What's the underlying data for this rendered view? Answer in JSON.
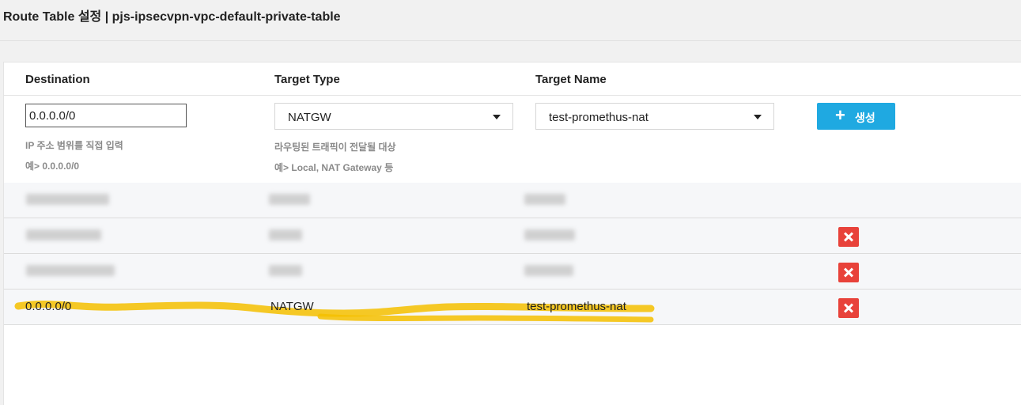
{
  "page": {
    "title": "Route Table 설정 | pjs-ipsecvpn-vpc-default-private-table"
  },
  "table": {
    "headers": {
      "destination": "Destination",
      "target_type": "Target Type",
      "target_name": "Target Name"
    },
    "new_route": {
      "destination_value": "0.0.0.0/0",
      "destination_hint_1": "IP 주소 범위를 직접 입력",
      "destination_hint_2": "예> 0.0.0.0/0",
      "target_type_value": "NATGW",
      "target_type_hint_1": "라우팅된 트래픽이 전달될 대상",
      "target_type_hint_2": "예> Local, NAT Gateway 등",
      "target_name_value": "test-promethus-nat",
      "create_label": "생성",
      "create_icon": "plus-icon"
    },
    "rows": [
      {
        "destination": "",
        "target_type": "",
        "target_name": "",
        "redacted": true,
        "deletable": false
      },
      {
        "destination": "",
        "target_type": "",
        "target_name": "",
        "redacted": true,
        "deletable": true
      },
      {
        "destination": "",
        "target_type": "",
        "target_name": "",
        "redacted": true,
        "deletable": true
      },
      {
        "destination": "0.0.0.0/0",
        "target_type": "NATGW",
        "target_name": "test-promethus-nat",
        "redacted": false,
        "deletable": true
      }
    ],
    "delete_icon": "close-icon"
  },
  "colors": {
    "create_button": "#1fa9e1",
    "delete_button": "#e8423a",
    "highlight": "#f5c000"
  }
}
